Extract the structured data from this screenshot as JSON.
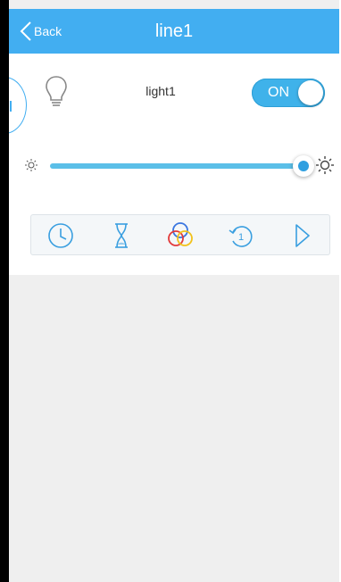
{
  "header": {
    "title": "line1",
    "back_label": "Back"
  },
  "device": {
    "name": "light1",
    "power_label": "ON",
    "power_on": true
  },
  "brightness": {
    "level": 1.0
  },
  "toolbar": {
    "icons": [
      "clock-icon",
      "hourglass-icon",
      "color-mix-icon",
      "cycle-icon",
      "play-icon"
    ]
  },
  "colors": {
    "accent": "#42aef1",
    "icon_blue": "#3a9fe0",
    "slider": "#5bbfe8",
    "background": "#efefef"
  }
}
